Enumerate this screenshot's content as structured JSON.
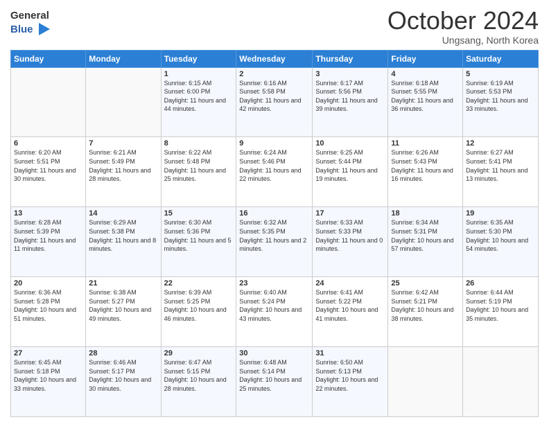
{
  "header": {
    "logo_line1": "General",
    "logo_line2": "Blue",
    "month": "October 2024",
    "location": "Ungsang, North Korea"
  },
  "weekdays": [
    "Sunday",
    "Monday",
    "Tuesday",
    "Wednesday",
    "Thursday",
    "Friday",
    "Saturday"
  ],
  "weeks": [
    [
      {
        "day": "",
        "info": ""
      },
      {
        "day": "",
        "info": ""
      },
      {
        "day": "1",
        "info": "Sunrise: 6:15 AM\nSunset: 6:00 PM\nDaylight: 11 hours and 44 minutes."
      },
      {
        "day": "2",
        "info": "Sunrise: 6:16 AM\nSunset: 5:58 PM\nDaylight: 11 hours and 42 minutes."
      },
      {
        "day": "3",
        "info": "Sunrise: 6:17 AM\nSunset: 5:56 PM\nDaylight: 11 hours and 39 minutes."
      },
      {
        "day": "4",
        "info": "Sunrise: 6:18 AM\nSunset: 5:55 PM\nDaylight: 11 hours and 36 minutes."
      },
      {
        "day": "5",
        "info": "Sunrise: 6:19 AM\nSunset: 5:53 PM\nDaylight: 11 hours and 33 minutes."
      }
    ],
    [
      {
        "day": "6",
        "info": "Sunrise: 6:20 AM\nSunset: 5:51 PM\nDaylight: 11 hours and 30 minutes."
      },
      {
        "day": "7",
        "info": "Sunrise: 6:21 AM\nSunset: 5:49 PM\nDaylight: 11 hours and 28 minutes."
      },
      {
        "day": "8",
        "info": "Sunrise: 6:22 AM\nSunset: 5:48 PM\nDaylight: 11 hours and 25 minutes."
      },
      {
        "day": "9",
        "info": "Sunrise: 6:24 AM\nSunset: 5:46 PM\nDaylight: 11 hours and 22 minutes."
      },
      {
        "day": "10",
        "info": "Sunrise: 6:25 AM\nSunset: 5:44 PM\nDaylight: 11 hours and 19 minutes."
      },
      {
        "day": "11",
        "info": "Sunrise: 6:26 AM\nSunset: 5:43 PM\nDaylight: 11 hours and 16 minutes."
      },
      {
        "day": "12",
        "info": "Sunrise: 6:27 AM\nSunset: 5:41 PM\nDaylight: 11 hours and 13 minutes."
      }
    ],
    [
      {
        "day": "13",
        "info": "Sunrise: 6:28 AM\nSunset: 5:39 PM\nDaylight: 11 hours and 11 minutes."
      },
      {
        "day": "14",
        "info": "Sunrise: 6:29 AM\nSunset: 5:38 PM\nDaylight: 11 hours and 8 minutes."
      },
      {
        "day": "15",
        "info": "Sunrise: 6:30 AM\nSunset: 5:36 PM\nDaylight: 11 hours and 5 minutes."
      },
      {
        "day": "16",
        "info": "Sunrise: 6:32 AM\nSunset: 5:35 PM\nDaylight: 11 hours and 2 minutes."
      },
      {
        "day": "17",
        "info": "Sunrise: 6:33 AM\nSunset: 5:33 PM\nDaylight: 11 hours and 0 minutes."
      },
      {
        "day": "18",
        "info": "Sunrise: 6:34 AM\nSunset: 5:31 PM\nDaylight: 10 hours and 57 minutes."
      },
      {
        "day": "19",
        "info": "Sunrise: 6:35 AM\nSunset: 5:30 PM\nDaylight: 10 hours and 54 minutes."
      }
    ],
    [
      {
        "day": "20",
        "info": "Sunrise: 6:36 AM\nSunset: 5:28 PM\nDaylight: 10 hours and 51 minutes."
      },
      {
        "day": "21",
        "info": "Sunrise: 6:38 AM\nSunset: 5:27 PM\nDaylight: 10 hours and 49 minutes."
      },
      {
        "day": "22",
        "info": "Sunrise: 6:39 AM\nSunset: 5:25 PM\nDaylight: 10 hours and 46 minutes."
      },
      {
        "day": "23",
        "info": "Sunrise: 6:40 AM\nSunset: 5:24 PM\nDaylight: 10 hours and 43 minutes."
      },
      {
        "day": "24",
        "info": "Sunrise: 6:41 AM\nSunset: 5:22 PM\nDaylight: 10 hours and 41 minutes."
      },
      {
        "day": "25",
        "info": "Sunrise: 6:42 AM\nSunset: 5:21 PM\nDaylight: 10 hours and 38 minutes."
      },
      {
        "day": "26",
        "info": "Sunrise: 6:44 AM\nSunset: 5:19 PM\nDaylight: 10 hours and 35 minutes."
      }
    ],
    [
      {
        "day": "27",
        "info": "Sunrise: 6:45 AM\nSunset: 5:18 PM\nDaylight: 10 hours and 33 minutes."
      },
      {
        "day": "28",
        "info": "Sunrise: 6:46 AM\nSunset: 5:17 PM\nDaylight: 10 hours and 30 minutes."
      },
      {
        "day": "29",
        "info": "Sunrise: 6:47 AM\nSunset: 5:15 PM\nDaylight: 10 hours and 28 minutes."
      },
      {
        "day": "30",
        "info": "Sunrise: 6:48 AM\nSunset: 5:14 PM\nDaylight: 10 hours and 25 minutes."
      },
      {
        "day": "31",
        "info": "Sunrise: 6:50 AM\nSunset: 5:13 PM\nDaylight: 10 hours and 22 minutes."
      },
      {
        "day": "",
        "info": ""
      },
      {
        "day": "",
        "info": ""
      }
    ]
  ]
}
